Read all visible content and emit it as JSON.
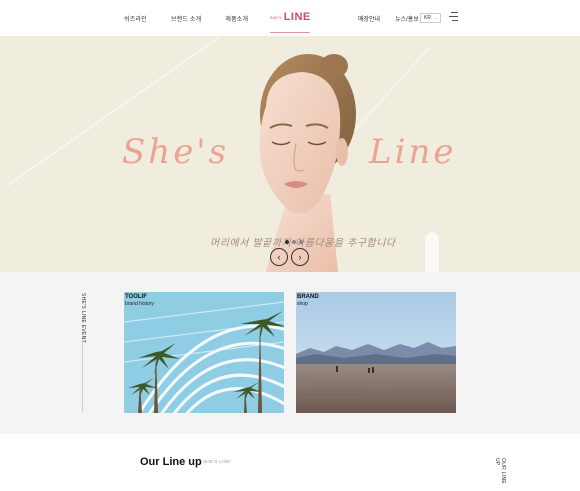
{
  "header": {
    "nav_left": [
      "쉬즈라인",
      "브랜드 소개",
      "제품소개"
    ],
    "logo_small": "SHE'S",
    "logo_main": "LINE",
    "nav_right": [
      "매장안내",
      "뉴스/홍보"
    ],
    "lang": "KR",
    "menu_icon": "hamburger-icon"
  },
  "hero": {
    "title_left": "She's",
    "title_right": "Line",
    "subtitle": "머리에서 발끝까지 아름다움을 추구합니다",
    "prev_icon": "chevron-left-icon",
    "next_icon": "chevron-right-icon",
    "slides": 3,
    "active_slide": 1
  },
  "event": {
    "vertical_label": "SHE'S LINE EVENT",
    "cards": [
      {
        "title": "TOOLIF",
        "sub": "brand history"
      },
      {
        "title": "BRAND",
        "sub": "shop"
      }
    ]
  },
  "lineup": {
    "title": "Our Line up",
    "sub": "SHE'S LINE",
    "vertical_label": "OUR LINE UP"
  },
  "colors": {
    "accent": "#d24a63",
    "hero_bg": "#f0ecde",
    "hero_title": "#eba48f"
  }
}
